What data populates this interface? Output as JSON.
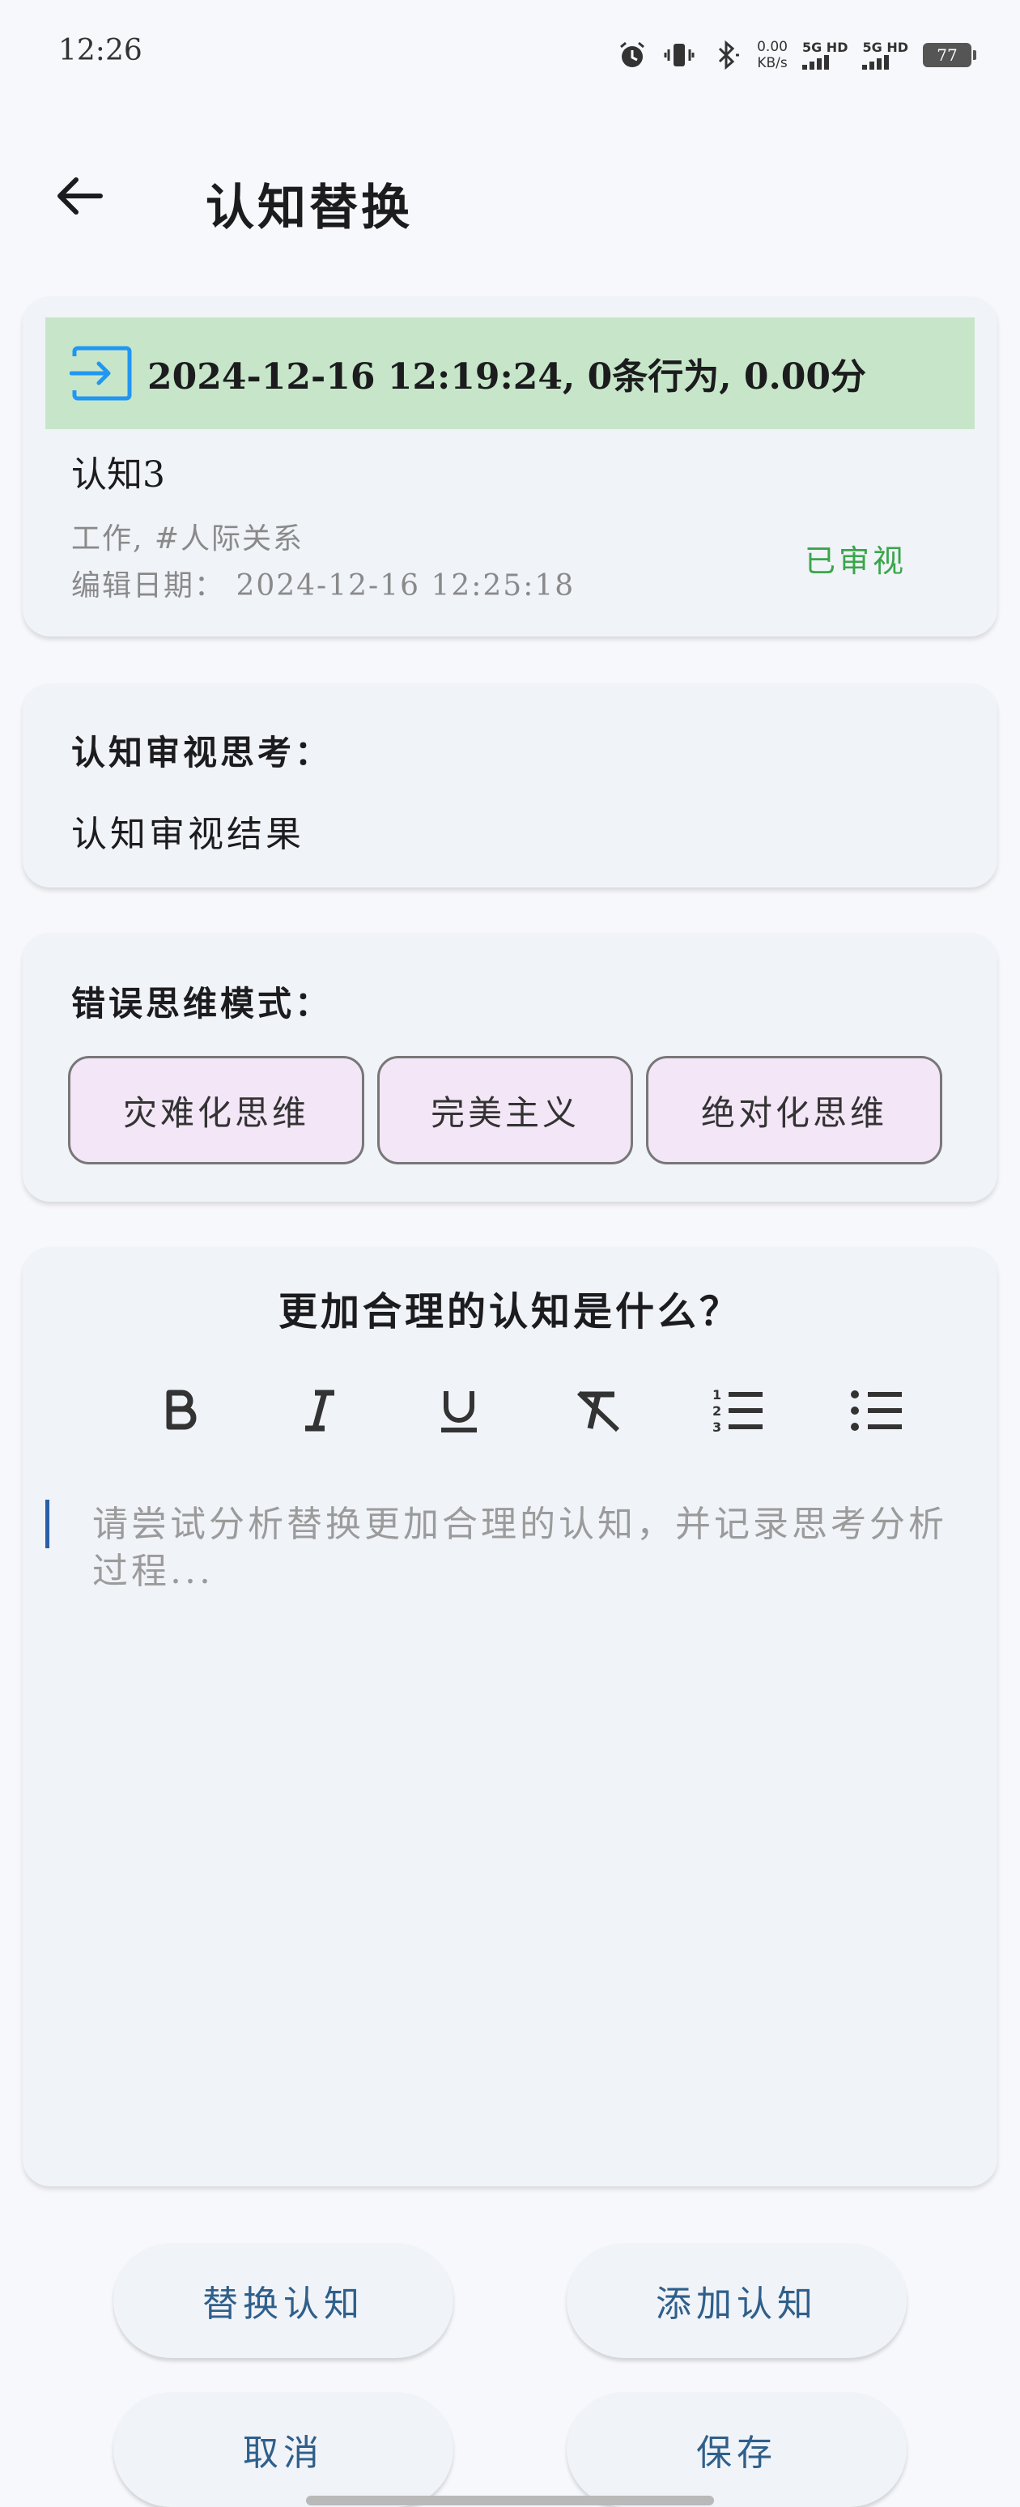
{
  "status_bar": {
    "time": "12:26",
    "net_speed_value": "0.00",
    "net_speed_unit": "KB/s",
    "sim1_label": "5G HD",
    "sim2_label": "5G HD",
    "battery": "77"
  },
  "header": {
    "title": "认知替换"
  },
  "record": {
    "header_text": "2024-12-16 12:19:24, 0条行为, 0.00分",
    "title": "认知3",
    "tags": "工作, #人际关系",
    "date": "编辑日期： 2024-12-16 12:25:18",
    "status": "已审视",
    "header_color": "#c7e6c9",
    "status_color": "#3aa64a"
  },
  "review": {
    "label": "认知审视思考：",
    "text": "认知审视结果"
  },
  "errors": {
    "label": "错误思维模式：",
    "chips": [
      "灾难化思维",
      "完美主义",
      "绝对化思维"
    ]
  },
  "editor": {
    "title": "更加合理的认知是什么？",
    "placeholder": "请尝试分析替换更加合理的认知，并记录思考分析过程...",
    "tools": [
      "bold-icon",
      "italic-icon",
      "underline-icon",
      "clear-format-icon",
      "numbered-list-icon",
      "bullet-list-icon"
    ]
  },
  "buttons": {
    "replace": "替换认知",
    "add": "添加认知",
    "cancel": "取消",
    "save": "保存"
  }
}
